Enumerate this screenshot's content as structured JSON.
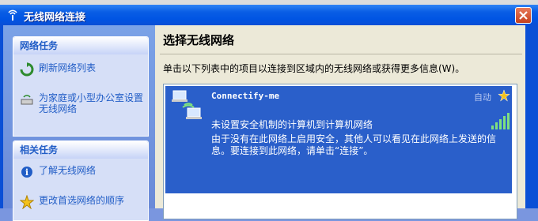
{
  "window": {
    "title": "无线网络连接"
  },
  "sidebar": {
    "network_tasks": {
      "header": "网络任务",
      "items": [
        {
          "label": "刷新网络列表",
          "icon": "refresh-icon"
        },
        {
          "label": "为家庭或小型办公室设置无线网络",
          "icon": "wireless-setup-icon"
        }
      ]
    },
    "related_tasks": {
      "header": "相关任务",
      "items": [
        {
          "label": "了解无线网络",
          "icon": "info-icon"
        },
        {
          "label": "更改首选网络的顺序",
          "icon": "star-icon"
        }
      ]
    }
  },
  "main": {
    "heading": "选择无线网络",
    "instruction": "单击以下列表中的项目以连接到区域内的无线网络或获得更多信息(W)。",
    "networks": [
      {
        "ssid": "Connectify-me",
        "status": "自动",
        "security": "未设置安全机制的计算机到计算机网络",
        "description": "由于没有在此网络上启用安全，其他人可以看见在此网络上发送的信息。要连接到此网络，请单击“连接”。",
        "signal_level": 5
      }
    ]
  },
  "colors": {
    "selection": "#2a5fca",
    "link": "#215dc6",
    "titlebar": "#0054e3"
  }
}
